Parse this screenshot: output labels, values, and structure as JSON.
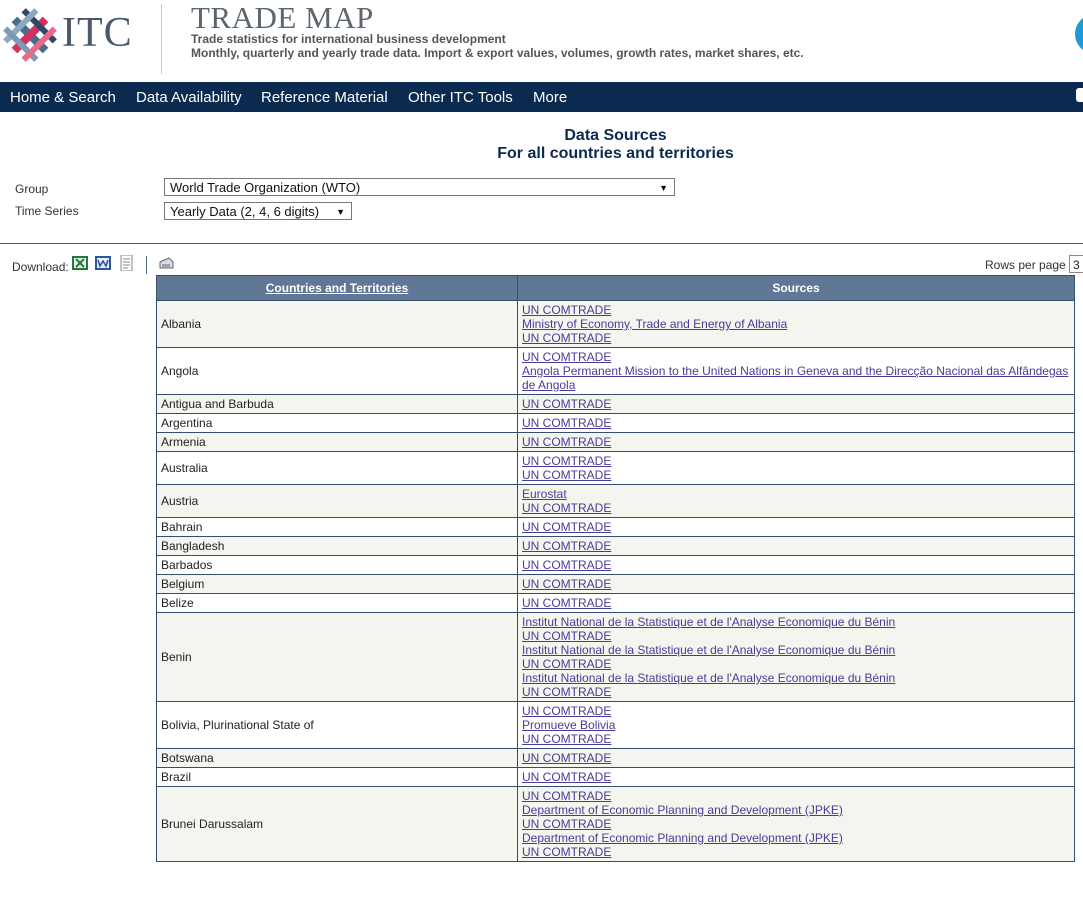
{
  "header": {
    "logo_text": "ITC",
    "title": "TRADE MAP",
    "subtitle1": "Trade statistics for international business development",
    "subtitle2": "Monthly, quarterly and yearly trade data. Import & export values, volumes, growth rates, market shares, etc."
  },
  "nav": {
    "items": [
      "Home & Search",
      "Data Availability",
      "Reference Material",
      "Other ITC Tools",
      "More"
    ]
  },
  "page": {
    "title1": "Data Sources",
    "title2": "For all countries and territories"
  },
  "filters": {
    "group_label": "Group",
    "group_value": "World Trade Organization (WTO)",
    "time_label": "Time Series",
    "time_value": "Yearly Data (2, 4, 6 digits)"
  },
  "toolbar": {
    "download_label": "Download:",
    "rows_per_page_label": "Rows per page",
    "rows_per_page_value": "3"
  },
  "table": {
    "headers": [
      "Countries and Territories",
      "Sources"
    ],
    "rows": [
      {
        "country": "Albania",
        "sources": [
          "UN COMTRADE",
          "Ministry of Economy, Trade and Energy of Albania",
          "UN COMTRADE"
        ]
      },
      {
        "country": "Angola",
        "sources": [
          "UN COMTRADE",
          "Angola Permanent Mission to the United Nations in Geneva and the Direcção Nacional das Alfândegas de Angola"
        ]
      },
      {
        "country": "Antigua and Barbuda",
        "sources": [
          "UN COMTRADE"
        ]
      },
      {
        "country": "Argentina",
        "sources": [
          "UN COMTRADE"
        ]
      },
      {
        "country": "Armenia",
        "sources": [
          "UN COMTRADE"
        ]
      },
      {
        "country": "Australia",
        "sources": [
          "UN COMTRADE",
          "UN COMTRADE"
        ]
      },
      {
        "country": "Austria",
        "sources": [
          "Eurostat",
          "UN COMTRADE"
        ]
      },
      {
        "country": "Bahrain",
        "sources": [
          "UN COMTRADE"
        ]
      },
      {
        "country": "Bangladesh",
        "sources": [
          "UN COMTRADE"
        ]
      },
      {
        "country": "Barbados",
        "sources": [
          "UN COMTRADE"
        ]
      },
      {
        "country": "Belgium",
        "sources": [
          "UN COMTRADE"
        ]
      },
      {
        "country": "Belize",
        "sources": [
          "UN COMTRADE"
        ]
      },
      {
        "country": "Benin",
        "sources": [
          "Institut National de la Statistique et de l'Analyse Economique du Bénin",
          "UN COMTRADE",
          "Institut National de la Statistique et de l'Analyse Economique du Bénin",
          "UN COMTRADE",
          "Institut National de la Statistique et de l'Analyse Economique du Bénin",
          "UN COMTRADE"
        ]
      },
      {
        "country": "Bolivia, Plurinational State of",
        "sources": [
          "UN COMTRADE",
          "Promueve Bolivia",
          "UN COMTRADE"
        ]
      },
      {
        "country": "Botswana",
        "sources": [
          "UN COMTRADE"
        ]
      },
      {
        "country": "Brazil",
        "sources": [
          "UN COMTRADE"
        ]
      },
      {
        "country": "Brunei Darussalam",
        "sources": [
          "UN COMTRADE",
          "Department of Economic Planning and Development (JPKE)",
          "UN COMTRADE",
          "Department of Economic Planning and Development (JPKE)",
          "UN COMTRADE"
        ]
      }
    ]
  },
  "colors": {
    "nav_bg": "#0b2a4f",
    "table_header_bg": "#607896",
    "link": "#4a3b9a",
    "accent_blue": "#1e9ad6"
  }
}
